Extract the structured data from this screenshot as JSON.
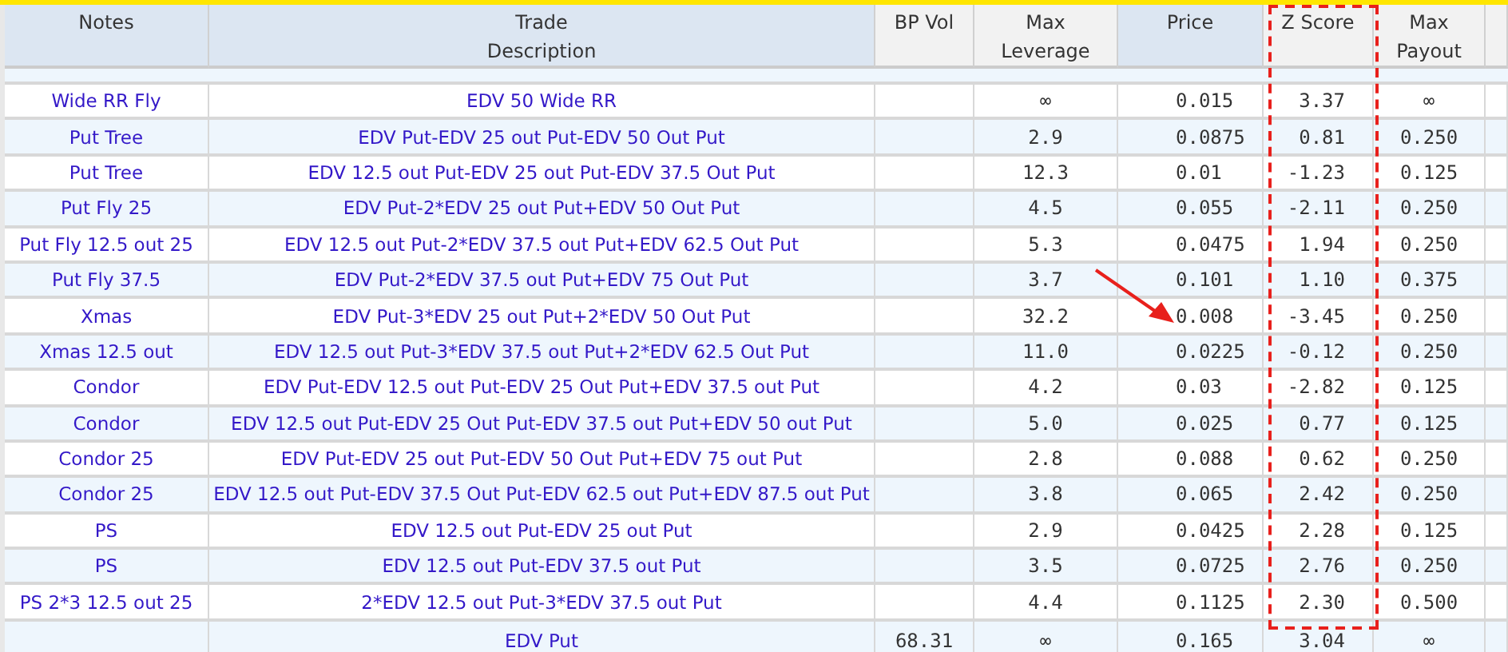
{
  "table": {
    "columns": [
      {
        "label": "Notes",
        "shaded": true,
        "highlighted": false,
        "kind": "text"
      },
      {
        "label": "Trade\nDescription",
        "shaded": true,
        "highlighted": false,
        "kind": "text"
      },
      {
        "label": "BP Vol",
        "shaded": false,
        "highlighted": false,
        "kind": "center"
      },
      {
        "label": "Max\nLeverage",
        "shaded": false,
        "highlighted": false,
        "kind": "center"
      },
      {
        "label": "Price",
        "shaded": true,
        "highlighted": false,
        "kind": "left"
      },
      {
        "label": "Z Score",
        "shaded": false,
        "highlighted": true,
        "kind": "right"
      },
      {
        "label": "Max\nPayout",
        "shaded": false,
        "highlighted": false,
        "kind": "center"
      }
    ],
    "rows": [
      {
        "cells": [
          "Wide RR Fly",
          "EDV 50 Wide RR",
          "",
          "∞",
          "0.015",
          "3.37",
          "∞"
        ]
      },
      {
        "cells": [
          "Put Tree",
          "EDV Put-EDV 25 out Put-EDV 50 Out Put",
          "",
          "2.9",
          "0.0875",
          "0.81",
          "0.250"
        ]
      },
      {
        "cells": [
          "Put Tree",
          "EDV 12.5 out Put-EDV 25 out Put-EDV 37.5 Out Put",
          "",
          "12.3",
          "0.01",
          "-1.23",
          "0.125"
        ]
      },
      {
        "cells": [
          "Put Fly 25",
          "EDV Put-2*EDV 25 out Put+EDV 50 Out Put",
          "",
          "4.5",
          "0.055",
          "-2.11",
          "0.250"
        ]
      },
      {
        "cells": [
          "Put Fly 12.5 out 25",
          "EDV 12.5 out Put-2*EDV 37.5 out Put+EDV 62.5 Out Put",
          "",
          "5.3",
          "0.0475",
          "1.94",
          "0.250"
        ]
      },
      {
        "cells": [
          "Put Fly 37.5",
          "EDV Put-2*EDV 37.5 out Put+EDV 75 Out Put",
          "",
          "3.7",
          "0.101",
          "1.10",
          "0.375"
        ]
      },
      {
        "cells": [
          "Xmas",
          "EDV Put-3*EDV 25 out Put+2*EDV 50 Out Put",
          "",
          "32.2",
          "0.008",
          "-3.45",
          "0.250"
        ]
      },
      {
        "cells": [
          "Xmas 12.5 out",
          "EDV 12.5 out Put-3*EDV 37.5 out Put+2*EDV 62.5 Out Put",
          "",
          "11.0",
          "0.0225",
          "-0.12",
          "0.250"
        ]
      },
      {
        "cells": [
          "Condor",
          "EDV Put-EDV 12.5 out Put-EDV 25 Out Put+EDV 37.5 out Put",
          "",
          "4.2",
          "0.03",
          "-2.82",
          "0.125"
        ]
      },
      {
        "cells": [
          "Condor",
          "EDV 12.5 out Put-EDV 25 Out Put-EDV 37.5 out Put+EDV 50 out Put",
          "",
          "5.0",
          "0.025",
          "0.77",
          "0.125"
        ]
      },
      {
        "cells": [
          "Condor 25",
          "EDV Put-EDV 25 out Put-EDV 50 Out Put+EDV 75 out Put",
          "",
          "2.8",
          "0.088",
          "0.62",
          "0.250"
        ]
      },
      {
        "cells": [
          "Condor 25",
          "EDV 12.5 out Put-EDV 37.5 Out Put-EDV 62.5 out Put+EDV 87.5 out Put",
          "",
          "3.8",
          "0.065",
          "2.42",
          "0.250"
        ]
      },
      {
        "cells": [
          "PS",
          "EDV 12.5 out Put-EDV 25 out Put",
          "",
          "2.9",
          "0.0425",
          "2.28",
          "0.125"
        ]
      },
      {
        "cells": [
          "PS",
          "EDV 12.5 out Put-EDV 37.5 out Put",
          "",
          "3.5",
          "0.0725",
          "2.76",
          "0.250"
        ]
      },
      {
        "cells": [
          "PS 2*3 12.5 out 25",
          "2*EDV 12.5 out Put-3*EDV 37.5 out Put",
          "",
          "4.4",
          "0.1125",
          "2.30",
          "0.500"
        ]
      },
      {
        "cells": [
          "",
          "EDV Put",
          "68.31",
          "∞",
          "0.165",
          "3.04",
          "∞"
        ]
      }
    ]
  }
}
